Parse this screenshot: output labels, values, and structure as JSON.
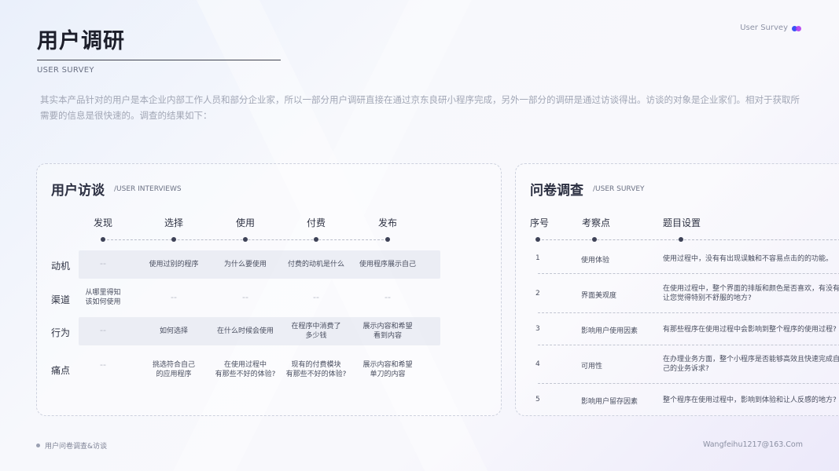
{
  "header": {
    "title": "用户调研",
    "subtitle": "USER SURVEY",
    "brand": "User Survey"
  },
  "intro": "其实本产品针对的用户是本企业内部工作人员和部分企业家，所以一部分用户调研直接在通过京东良研小程序完成，另外一部分的调研是通过访谈得出。访谈的对象是企业家们。相对于获取所需要的信息是很快速的。调查的结果如下：",
  "interviews": {
    "title": "用户访谈",
    "subtitle": "/USER INTERVIEWS",
    "columns": [
      "发现",
      "选择",
      "使用",
      "付费",
      "发布"
    ],
    "rows": [
      {
        "label": "动机",
        "cells": [
          "--",
          "使用过别的程序",
          "为什么要使用",
          "付费的动机是什么",
          "使用程序展示自己"
        ]
      },
      {
        "label": "渠道",
        "cells": [
          "从哪里得知\n该如何使用",
          "--",
          "--",
          "--",
          "--"
        ]
      },
      {
        "label": "行为",
        "cells": [
          "--",
          "如何选择",
          "在什么时候会使用",
          "在程序中消费了\n多少钱",
          "展示内容和希望\n看到内容"
        ]
      },
      {
        "label": "痛点",
        "cells": [
          "--",
          "挑选符合自己\n的应用程序",
          "在使用过程中\n有那些不好的体验?",
          "现有的付费模块\n有那些不好的体验?",
          "展示内容和希望\n单刀的内容"
        ]
      }
    ]
  },
  "survey": {
    "title": "问卷调查",
    "subtitle": "/USER SURVEY",
    "headers": [
      "序号",
      "考察点",
      "题目设置"
    ],
    "items": [
      {
        "num": "1",
        "point": "使用体验",
        "question": "使用过程中，没有有出现误触和不容易点击的的功能。"
      },
      {
        "num": "2",
        "point": "界面美观度",
        "question": "在使用过程中，整个界面的排版和颜色是否喜欢，有没有让您觉得特别不舒服的地方?"
      },
      {
        "num": "3",
        "point": "影响用户使用因素",
        "question": "有那些程序在使用过程中会影响到整个程序的使用过程?"
      },
      {
        "num": "4",
        "point": "可用性",
        "question": "在办理业务方面，整个小程序是否能够高效且快速完成自己的业务诉求?"
      },
      {
        "num": "5",
        "point": "影响用户留存因素",
        "question": "整个程序在使用过程中，影响到体验和让人反感的地方?"
      }
    ]
  },
  "footer": {
    "left": "用户问卷调查&访谈",
    "right": "Wangfeihu1217@163.Com"
  },
  "colors": {
    "accent_blue": "#3a55f5",
    "accent_purple": "#b23cf0"
  }
}
